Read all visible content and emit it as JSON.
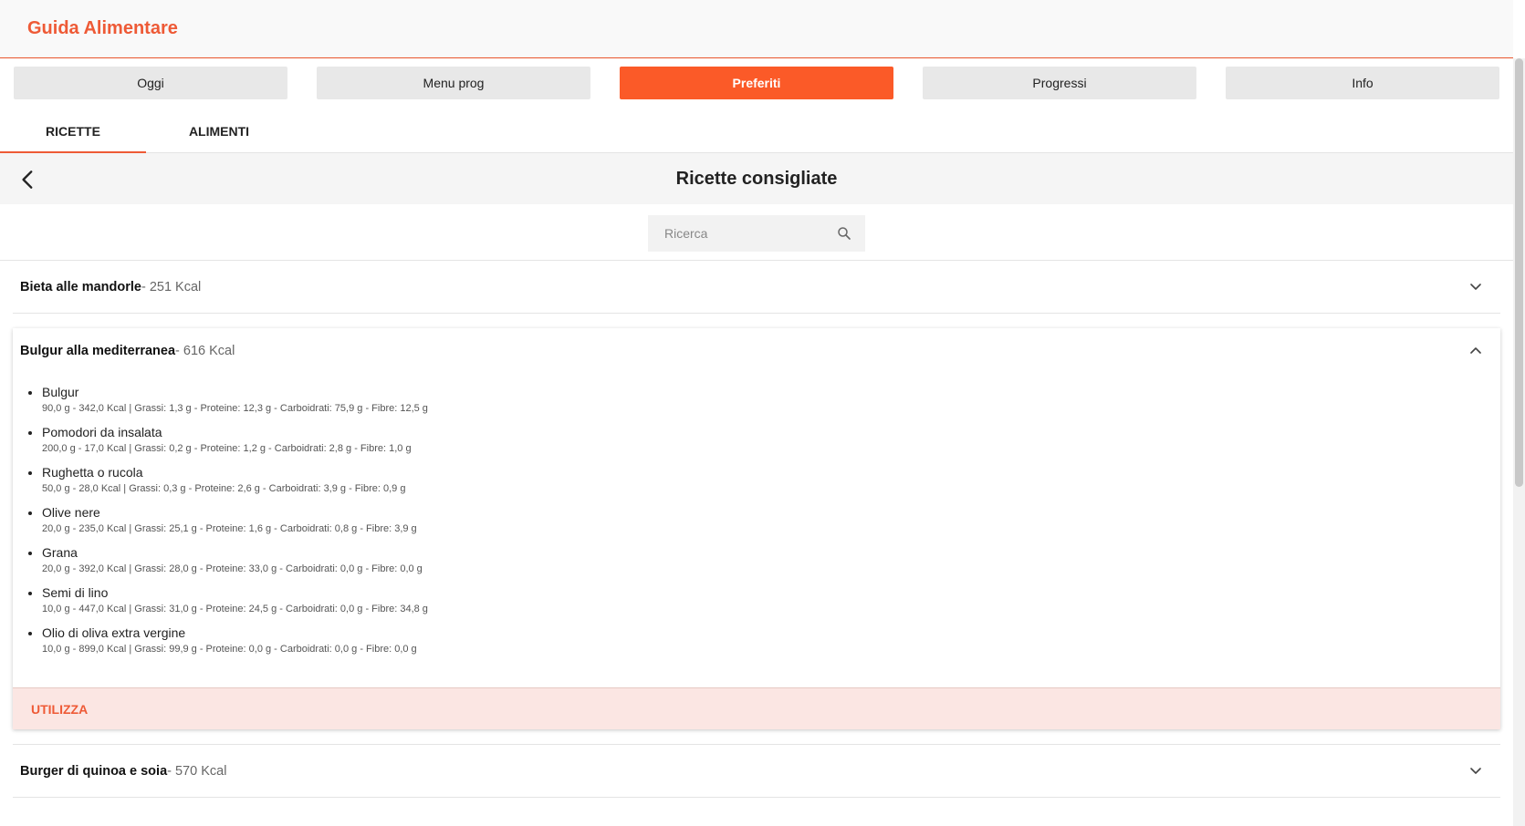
{
  "app": {
    "title": "Guida Alimentare"
  },
  "nav": {
    "items": [
      {
        "label": "Oggi"
      },
      {
        "label": "Menu prog"
      },
      {
        "label": "Preferiti"
      },
      {
        "label": "Progressi"
      },
      {
        "label": "Info"
      }
    ],
    "active": "Preferiti"
  },
  "tabs": [
    {
      "label": "RICETTE"
    },
    {
      "label": "ALIMENTI"
    }
  ],
  "page": {
    "title": "Ricette consigliate"
  },
  "search": {
    "placeholder": "Ricerca",
    "value": ""
  },
  "recipes": [
    {
      "name": "Bieta alle mandorle",
      "kcal": " - 251 Kcal",
      "expanded": false
    },
    {
      "name": "Bulgur alla mediterranea",
      "kcal": " - 616 Kcal",
      "expanded": true,
      "ingredients": [
        {
          "name": "Bulgur",
          "detail": "90,0 g - 342,0 Kcal   |   Grassi: 1,3 g   - Proteine: 12,3 g   - Carboidrati: 75,9 g   - Fibre: 12,5 g"
        },
        {
          "name": "Pomodori da insalata",
          "detail": "200,0 g - 17,0 Kcal   |   Grassi: 0,2 g   - Proteine: 1,2 g   - Carboidrati: 2,8 g   - Fibre: 1,0 g"
        },
        {
          "name": "Rughetta o rucola",
          "detail": "50,0 g - 28,0 Kcal   |   Grassi: 0,3 g   - Proteine: 2,6 g   - Carboidrati: 3,9 g   - Fibre: 0,9 g"
        },
        {
          "name": "Olive nere",
          "detail": "20,0 g - 235,0 Kcal   |   Grassi: 25,1 g   - Proteine: 1,6 g   - Carboidrati: 0,8 g   - Fibre: 3,9 g"
        },
        {
          "name": "Grana",
          "detail": "20,0 g - 392,0 Kcal   |   Grassi: 28,0 g   - Proteine: 33,0 g   - Carboidrati: 0,0 g   - Fibre: 0,0 g"
        },
        {
          "name": "Semi di lino",
          "detail": "10,0 g - 447,0 Kcal   |   Grassi: 31,0 g   - Proteine: 24,5 g   - Carboidrati: 0,0 g   - Fibre: 34,8 g"
        },
        {
          "name": "Olio di oliva extra vergine",
          "detail": "10,0 g - 899,0 Kcal   |   Grassi: 99,9 g   - Proteine: 0,0 g   - Carboidrati: 0,0 g   - Fibre: 0,0 g"
        }
      ],
      "action_label": "UTILIZZA"
    },
    {
      "name": "Burger di quinoa e soia",
      "kcal": " - 570 Kcal",
      "expanded": false
    }
  ],
  "colors": {
    "accent": "#fb5a28",
    "title": "#ee5a36",
    "action_bg": "#fbe6e3"
  },
  "icons": {
    "back": "chevron-left-icon",
    "search": "search-icon",
    "expand": "chevron-down-icon",
    "collapse": "chevron-up-icon"
  }
}
